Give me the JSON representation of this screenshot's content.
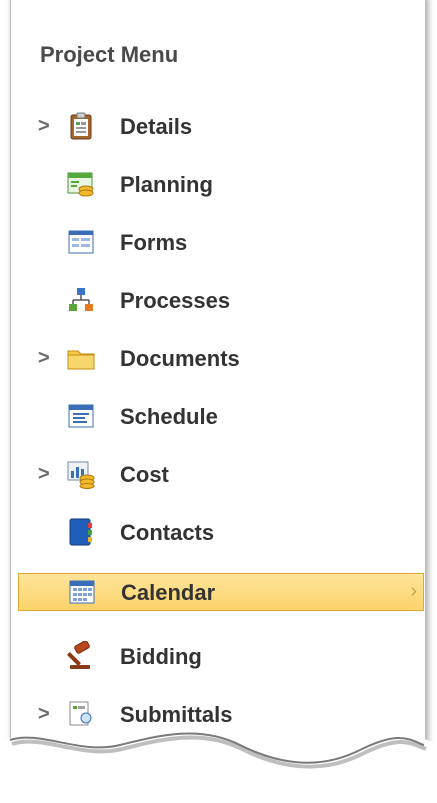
{
  "menu": {
    "title": "Project Menu",
    "items": [
      {
        "label": "Details",
        "icon": "clipboard-icon",
        "has_submenu": true
      },
      {
        "label": "Planning",
        "icon": "planning-icon",
        "has_submenu": false
      },
      {
        "label": "Forms",
        "icon": "forms-icon",
        "has_submenu": false
      },
      {
        "label": "Processes",
        "icon": "process-flow-icon",
        "has_submenu": false
      },
      {
        "label": "Documents",
        "icon": "folder-icon",
        "has_submenu": true
      },
      {
        "label": "Schedule",
        "icon": "schedule-icon",
        "has_submenu": false
      },
      {
        "label": "Cost",
        "icon": "cost-chart-icon",
        "has_submenu": true
      },
      {
        "label": "Contacts",
        "icon": "address-book-icon",
        "has_submenu": false
      },
      {
        "label": "Calendar",
        "icon": "calendar-icon",
        "has_submenu": false,
        "selected": true
      },
      {
        "label": "Bidding",
        "icon": "gavel-icon",
        "has_submenu": false
      },
      {
        "label": "Submittals",
        "icon": "submittals-icon",
        "has_submenu": true
      }
    ],
    "chevron_symbol": ">",
    "selected_right_chevron": "›"
  }
}
